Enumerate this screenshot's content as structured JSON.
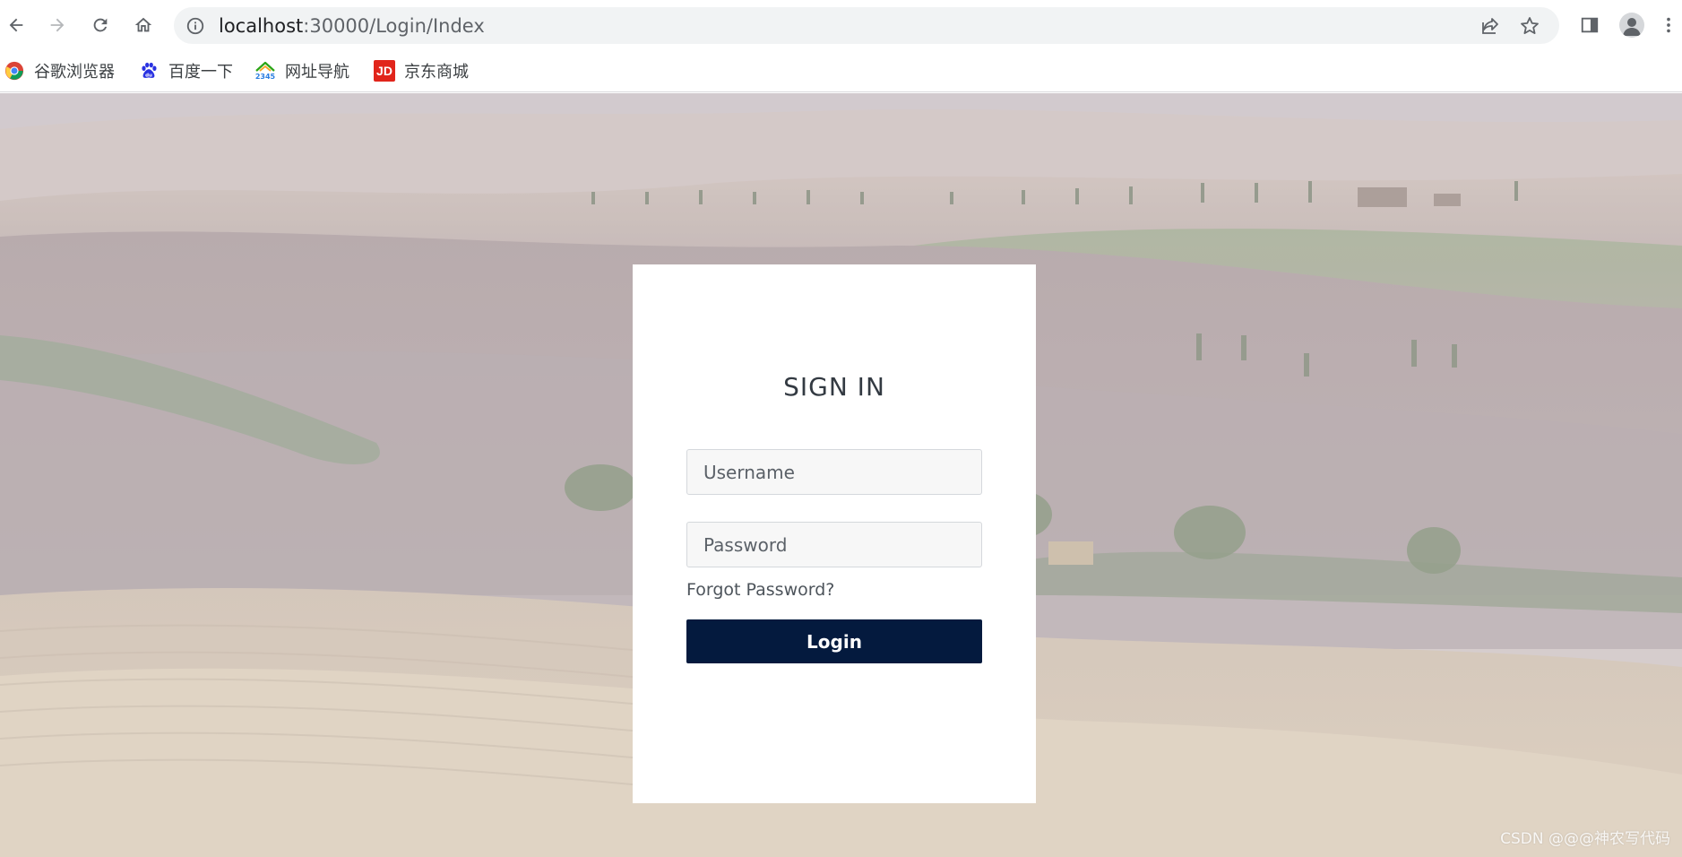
{
  "browser": {
    "url_host": "localhost",
    "url_rest": ":30000/Login/Index",
    "bookmarks": [
      {
        "label": "谷歌浏览器",
        "icon": "chrome-icon"
      },
      {
        "label": "百度一下",
        "icon": "baidu-paw-icon"
      },
      {
        "label": "网址导航",
        "icon": "2345-nav-icon"
      },
      {
        "label": "京东商城",
        "icon": "jd-icon",
        "icon_text": "JD"
      }
    ]
  },
  "login": {
    "title": "SIGN IN",
    "username_placeholder": "Username",
    "password_placeholder": "Password",
    "forgot_label": "Forgot Password?",
    "submit_label": "Login"
  },
  "watermark": "CSDN @@@神农写代码",
  "colors": {
    "button_bg": "#041a3e",
    "card_bg": "#ffffff",
    "jd_red": "#e1251b"
  }
}
